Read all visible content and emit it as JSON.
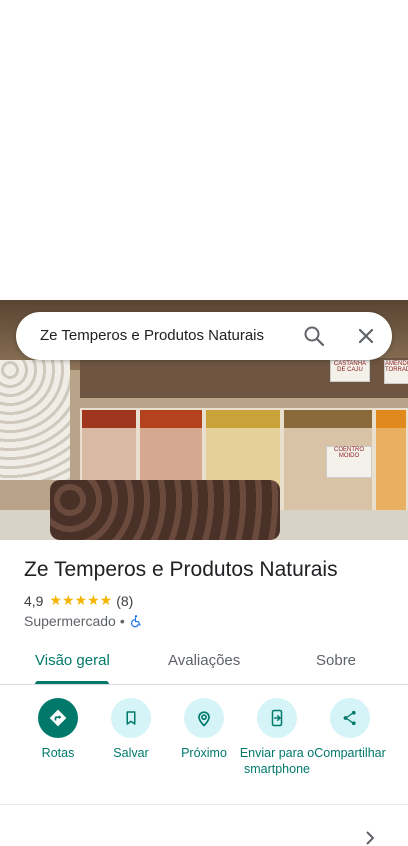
{
  "search": {
    "query": "Ze Temperos e Produtos Naturais"
  },
  "place": {
    "name": "Ze Temperos e Produtos Naturais",
    "rating": "4,9",
    "stars": "★★★★★",
    "review_count": "(8)",
    "category": "Supermercado",
    "separator": "•"
  },
  "tabs": [
    {
      "label": "Visão geral",
      "active": true
    },
    {
      "label": "Avaliações",
      "active": false
    },
    {
      "label": "Sobre",
      "active": false
    }
  ],
  "actions": [
    {
      "label": "Rotas",
      "icon": "directions-icon"
    },
    {
      "label": "Salvar",
      "icon": "bookmark-icon"
    },
    {
      "label": "Próximo",
      "icon": "nearby-icon"
    },
    {
      "label": "Enviar para o smartphone",
      "icon": "send-to-phone-icon"
    },
    {
      "label": "Compartilhar",
      "icon": "share-icon"
    }
  ],
  "photo_labels": [
    "CASTANHA DE CAJU",
    "AMENDOIM TORRADO",
    "COENTRO MOIDO"
  ],
  "colors": {
    "accent": "#00796b",
    "action_bg": "#d5f4f7",
    "star": "#f4b400"
  }
}
